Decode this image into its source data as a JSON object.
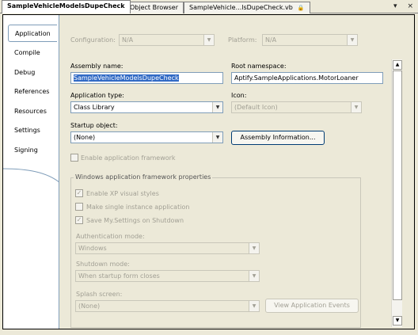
{
  "tabs": [
    {
      "label": "SampleVehicleModelsDupeCheck",
      "active": true
    },
    {
      "label": "Object Browser",
      "active": false
    },
    {
      "label": "SampleVehicle...lsDupeCheck.vb",
      "active": false
    }
  ],
  "tab_controls": {
    "dropdown_glyph": "▾",
    "close_glyph": "×"
  },
  "nav": [
    {
      "label": "Application",
      "active": true
    },
    {
      "label": "Compile"
    },
    {
      "label": "Debug"
    },
    {
      "label": "References"
    },
    {
      "label": "Resources"
    },
    {
      "label": "Settings"
    },
    {
      "label": "Signing"
    }
  ],
  "config": {
    "configuration_label": "Configuration:",
    "configuration_value": "N/A",
    "platform_label": "Platform:",
    "platform_value": "N/A"
  },
  "assembly": {
    "name_label": "Assembly name:",
    "name_value": "SampleVehicleModelsDupeCheck",
    "root_ns_label": "Root namespace:",
    "root_ns_value": "Aptify.SampleApplications.MotorLoaner"
  },
  "app_type": {
    "label": "Application type:",
    "value": "Class Library",
    "icon_label": "Icon:",
    "icon_value": "(Default Icon)"
  },
  "startup": {
    "label": "Startup object:",
    "value": "(None)",
    "assembly_info_button": "Assembly Information..."
  },
  "framework": {
    "enable_label": "Enable application framework"
  },
  "winprops": {
    "group_title": "Windows application framework properties",
    "xp_styles": "Enable XP visual styles",
    "single_instance": "Make single instance application",
    "save_settings": "Save My.Settings on Shutdown",
    "auth_label": "Authentication mode:",
    "auth_value": "Windows",
    "shutdown_label": "Shutdown mode:",
    "shutdown_value": "When startup form closes",
    "splash_label": "Splash screen:",
    "splash_value": "(None)",
    "view_events_button": "View Application Events"
  }
}
